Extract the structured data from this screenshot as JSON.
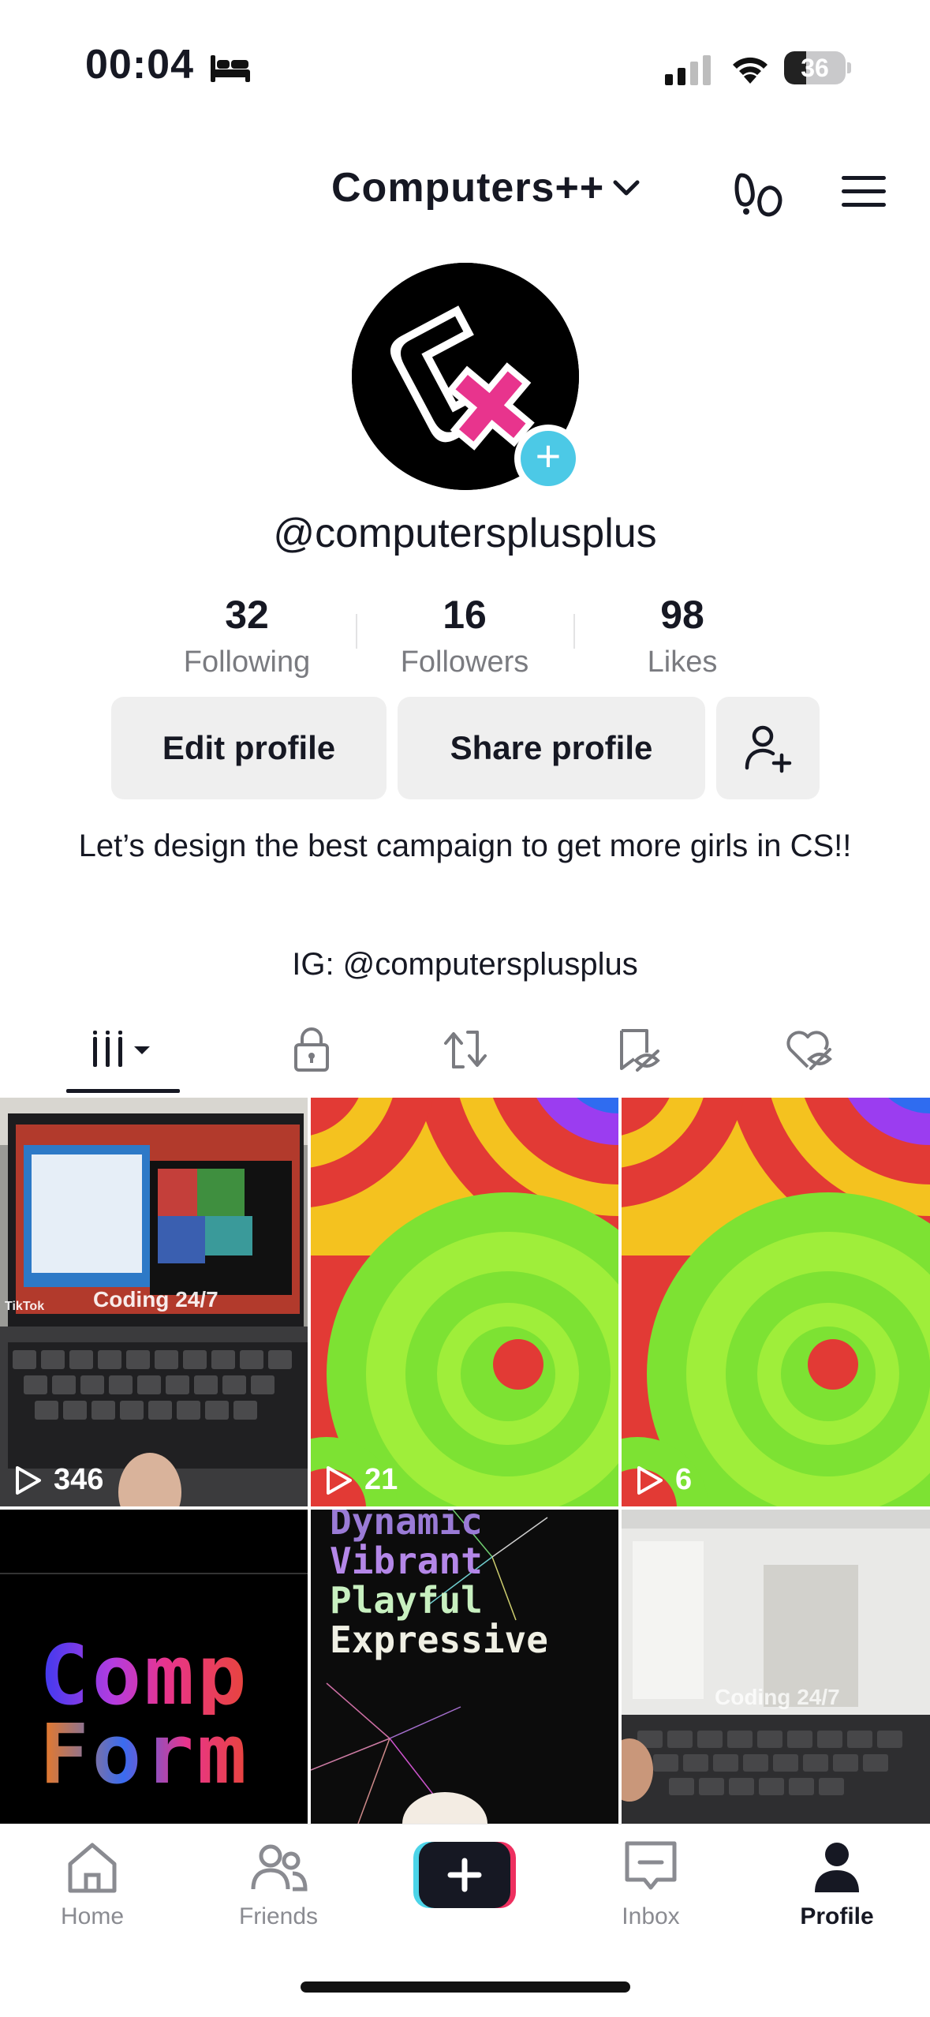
{
  "status_bar": {
    "time": "00:04",
    "battery": "36",
    "battery_level": 0.36
  },
  "header": {
    "account_name": "Computers++"
  },
  "profile": {
    "username": "@computersplusplus",
    "stats": [
      {
        "value": "32",
        "label": "Following"
      },
      {
        "value": "16",
        "label": "Followers"
      },
      {
        "value": "98",
        "label": "Likes"
      }
    ],
    "edit_label": "Edit profile",
    "share_label": "Share profile",
    "bio": "Let’s design the best campaign to get more girls in CS!!",
    "bio_link": "IG: @computersplusplus"
  },
  "tabs": [
    "videos-icon",
    "lock-icon",
    "repost-icon",
    "favorites-icon",
    "liked-icon"
  ],
  "videos": [
    {
      "views": "346",
      "caption": "Coding 24/7",
      "watermark": "TikTok"
    },
    {
      "views": "21"
    },
    {
      "views": "6"
    },
    {
      "text_lines": [
        "Comp",
        "Form"
      ]
    },
    {
      "text_lines": [
        "Dynamic",
        "Vibrant",
        "Playful",
        "Expressive"
      ]
    },
    {
      "caption": "Coding 24/7"
    }
  ],
  "nav": {
    "home": "Home",
    "friends": "Friends",
    "inbox": "Inbox",
    "profile": "Profile"
  },
  "colors": {
    "accent_cyan": "#4cc9e6",
    "accent_pink": "#e8348d",
    "text": "#161823"
  }
}
